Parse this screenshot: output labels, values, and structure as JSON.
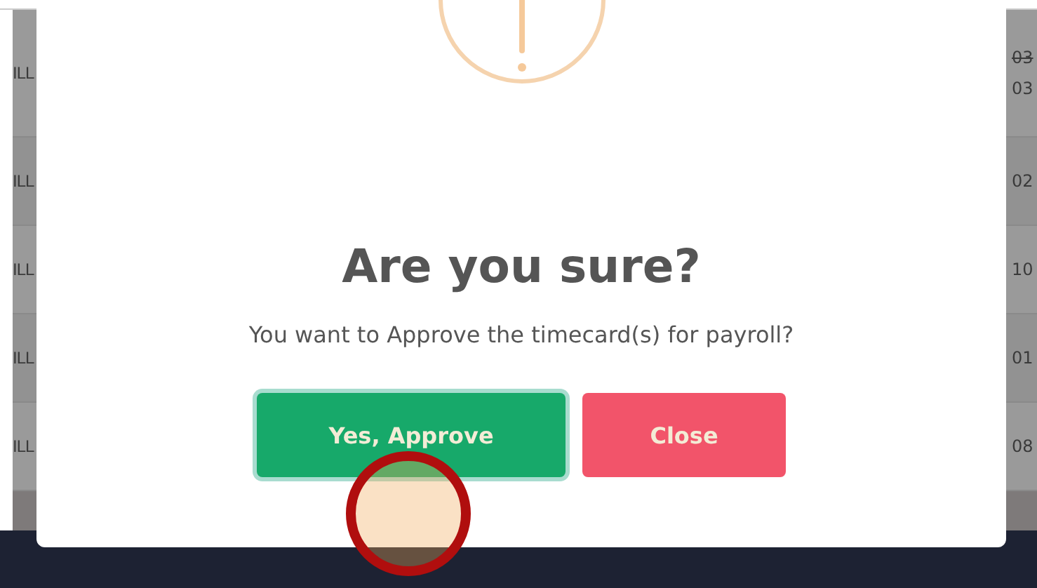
{
  "table": {
    "left_cells": [
      "ILL",
      "ILL",
      "ILL",
      "ILL",
      "ILL"
    ],
    "right_cells": [
      {
        "text": "03",
        "struck": true
      },
      {
        "text": "03",
        "struck": false
      },
      {
        "text": "02",
        "struck": false
      },
      {
        "text": "10",
        "struck": false
      },
      {
        "text": "01",
        "struck": false
      },
      {
        "text": "08",
        "struck": false
      }
    ]
  },
  "dialog": {
    "title": "Are you sure?",
    "message": "You want to Approve the timecard(s) for payroll?",
    "buttons": [
      {
        "label": "Yes, Approve",
        "kind": "confirm",
        "focused": true
      },
      {
        "label": "Close",
        "kind": "cancel",
        "focused": false
      }
    ]
  }
}
